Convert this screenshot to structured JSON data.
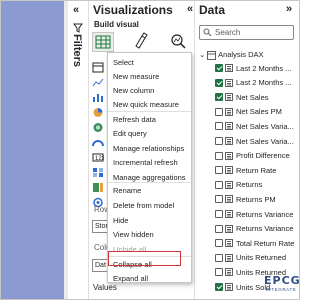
{
  "filters": {
    "label": "Filters",
    "collapse_glyph": "«"
  },
  "visualizations": {
    "title": "Visualizations",
    "collapse_glyph": "«",
    "build_visual": "Build visual",
    "frag_ro": "Row",
    "frag_sto": "Stor",
    "frag_colu": "Colu",
    "frag_dat": "Dat",
    "values_label": "Values"
  },
  "data": {
    "title": "Data",
    "collapse_glyph": "»",
    "search_placeholder": "Search",
    "root_label": "Analysis DAX",
    "items": [
      {
        "label": "Last 2 Months ...",
        "checked": true
      },
      {
        "label": "Last 2 Months ...",
        "checked": true
      },
      {
        "label": "Net Sales",
        "checked": true
      },
      {
        "label": "Net Sales PM",
        "checked": false
      },
      {
        "label": "Net Sales Varia...",
        "checked": false
      },
      {
        "label": "Net Sales Varia...",
        "checked": false
      },
      {
        "label": "Profit Difference",
        "checked": false
      },
      {
        "label": "Return Rate",
        "checked": false
      },
      {
        "label": "Returns",
        "checked": false
      },
      {
        "label": "Returns PM",
        "checked": false
      },
      {
        "label": "Returns Variance",
        "checked": false
      },
      {
        "label": "Returns Variance",
        "checked": false
      },
      {
        "label": "Total Return Rate",
        "checked": false
      },
      {
        "label": "Units Returned",
        "checked": false
      },
      {
        "label": "Units Returned",
        "checked": false
      },
      {
        "label": "Units Sold",
        "checked": true
      }
    ]
  },
  "context_menu": {
    "items": [
      {
        "label": "Select",
        "disabled": false
      },
      {
        "label": "New measure",
        "disabled": false
      },
      {
        "label": "New column",
        "disabled": false
      },
      {
        "label": "New quick measure",
        "disabled": false
      },
      {
        "label": "Refresh data",
        "disabled": false
      },
      {
        "label": "Edit query",
        "disabled": false
      },
      {
        "label": "Manage relationships",
        "disabled": false
      },
      {
        "label": "Incremental refresh",
        "disabled": false
      },
      {
        "label": "Manage aggregations",
        "disabled": false
      },
      {
        "label": "Rename",
        "disabled": false
      },
      {
        "label": "Delete from model",
        "disabled": false
      },
      {
        "label": "Hide",
        "disabled": false
      },
      {
        "label": "View hidden",
        "disabled": false
      },
      {
        "label": "Unhide all",
        "disabled": true
      },
      {
        "label": "Collapse all",
        "disabled": false,
        "highlighted": true
      },
      {
        "label": "Expand all",
        "disabled": false
      }
    ]
  },
  "watermark": {
    "text": "EPCG",
    "sub": "INTEGRATE"
  },
  "colors": {
    "accent_green": "#217346",
    "highlight_red": "#d13438",
    "canvas_blue": "#8b9ad0"
  }
}
